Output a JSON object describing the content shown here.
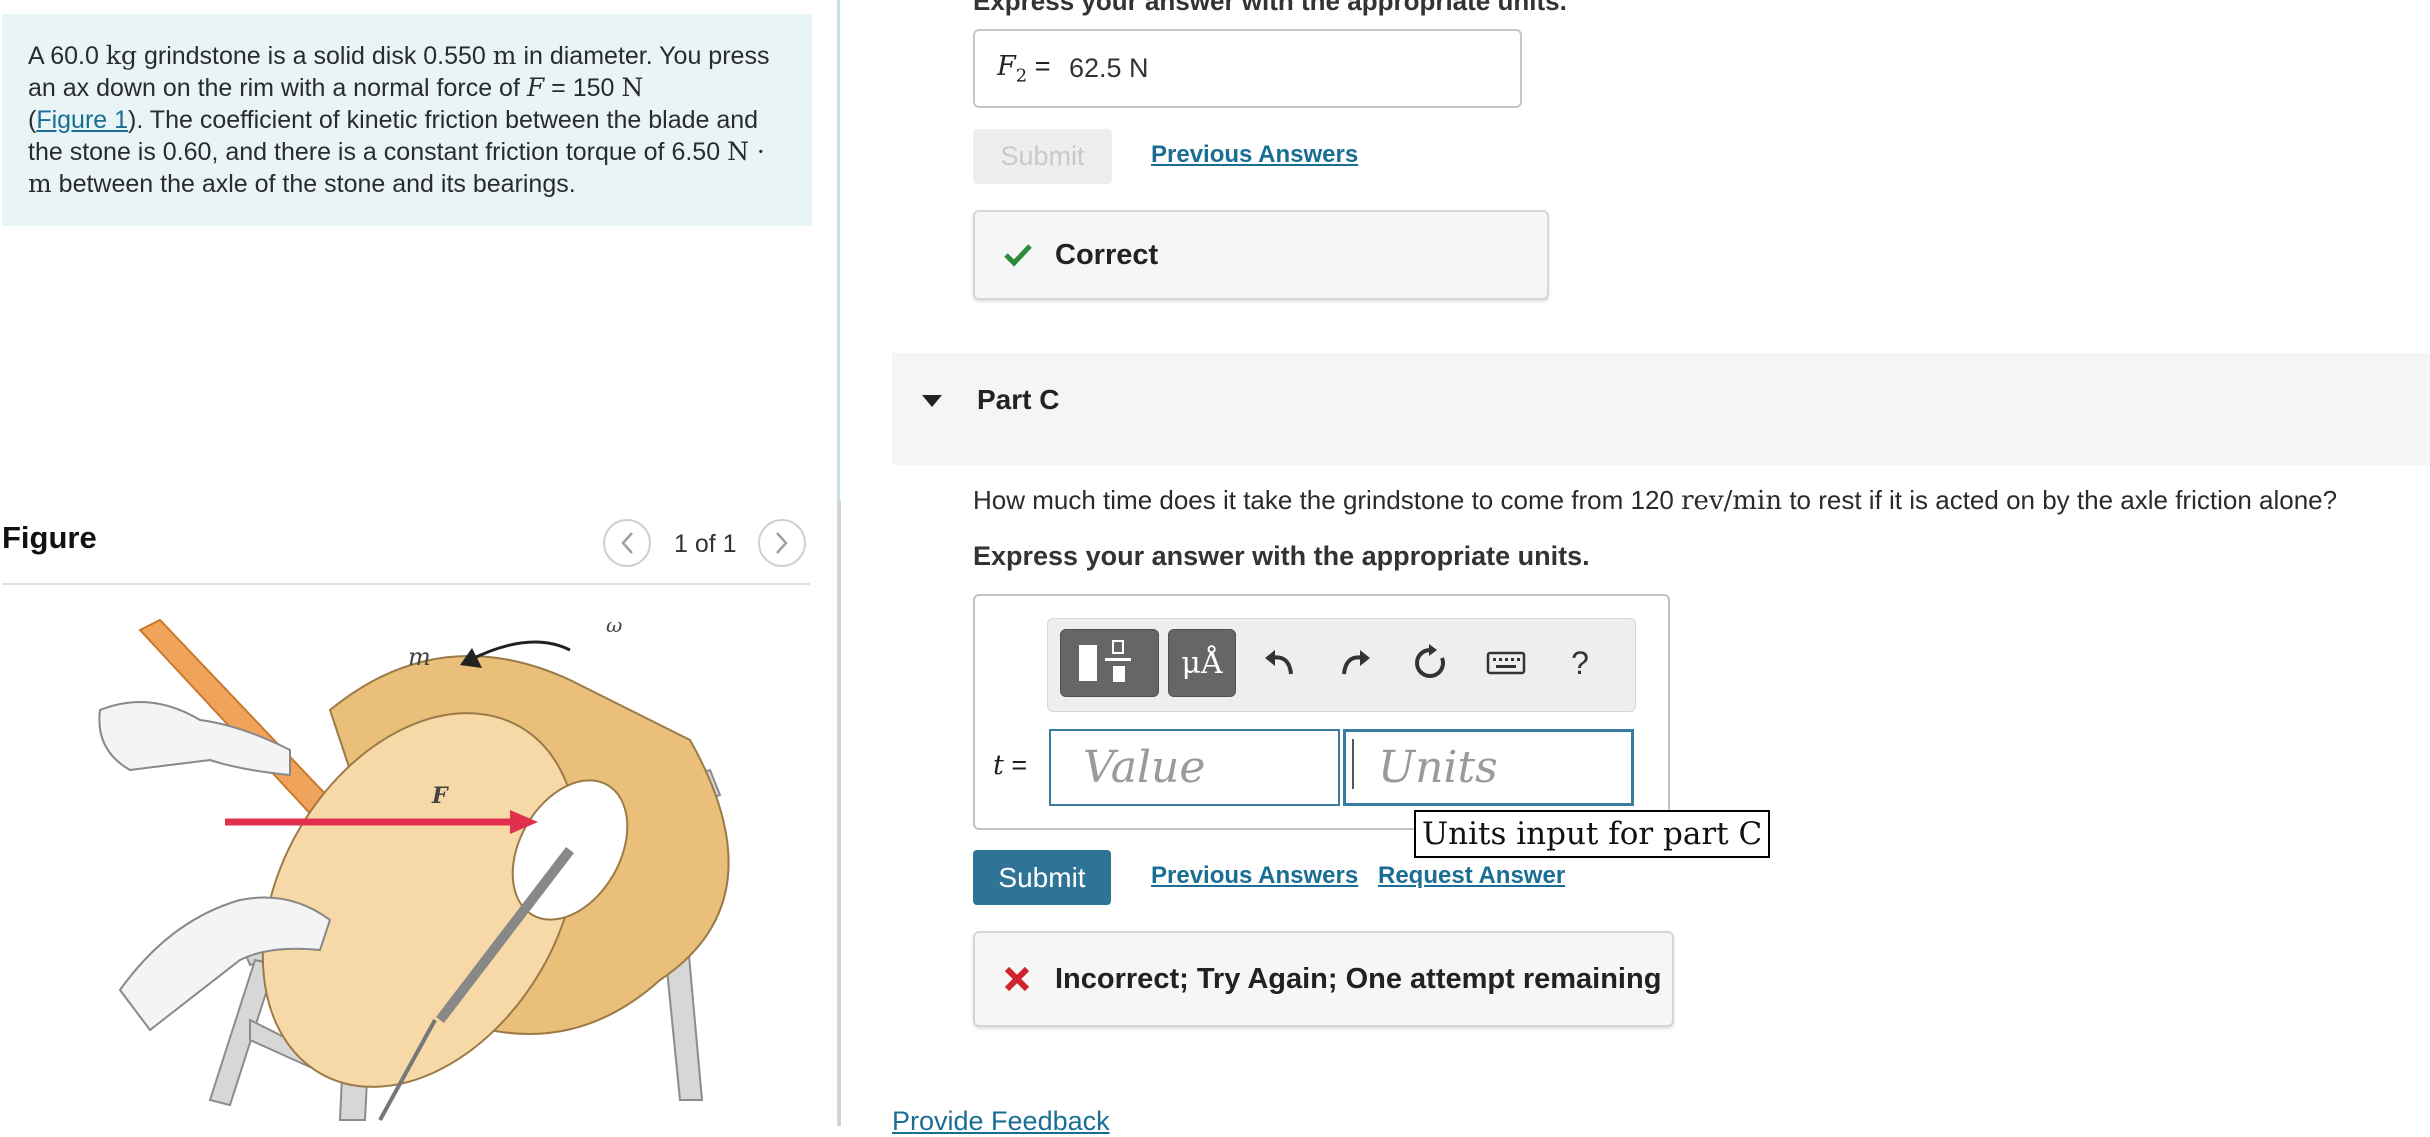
{
  "problem": {
    "t1": "A 60.0 ",
    "kg": "kg",
    "t2": " grindstone is a solid disk 0.550 ",
    "m": "m",
    "t3": " in diameter. You press an ax down on the rim with a normal force of ",
    "F": "F",
    "t4": " = 150 ",
    "N": "N",
    "t5": "(",
    "figure_link": "Figure 1",
    "t6": "). The coefficient of kinetic friction between the blade and the stone is 0.60, and there is a constant friction torque of 6.50 ",
    "Nm": "N · m",
    "t7": " between the axle of the stone and its bearings."
  },
  "figure": {
    "title": "Figure",
    "counter": "1 of 1",
    "labels": {
      "mass": "m",
      "force": "F",
      "omega": "ω"
    }
  },
  "part_b": {
    "instruction": "Express your answer with the appropriate units.",
    "answer_var": "F",
    "answer_sub": "2",
    "answer_eq": " = ",
    "answer_value": "62.5 N",
    "submit_label": "Submit",
    "previous_answers": "Previous Answers",
    "feedback": "Correct"
  },
  "part_c": {
    "title": "Part C",
    "question_pre": "How much time does it take the grindstone to come from 120 ",
    "question_unit": "rev/min",
    "question_post": " to rest if it is acted on by the axle friction alone?",
    "instruction": "Express your answer with the appropriate units.",
    "var_label": "t",
    "eq": " = ",
    "value_placeholder": "Value",
    "units_placeholder": "Units",
    "tooltip": "Units input for part C",
    "toolbar": {
      "units_btn": "μÅ",
      "help": "?"
    },
    "submit_label": "Submit",
    "previous_answers": "Previous Answers",
    "request_answer": "Request Answer",
    "feedback": "Incorrect; Try Again; One attempt remaining"
  },
  "footer": {
    "provide_feedback": "Provide Feedback"
  },
  "colors": {
    "accent": "#2f7496",
    "link": "#1a6e94",
    "correct": "#2e8b3e",
    "incorrect": "#d0222e",
    "problem_bg": "#e8f4f6"
  }
}
